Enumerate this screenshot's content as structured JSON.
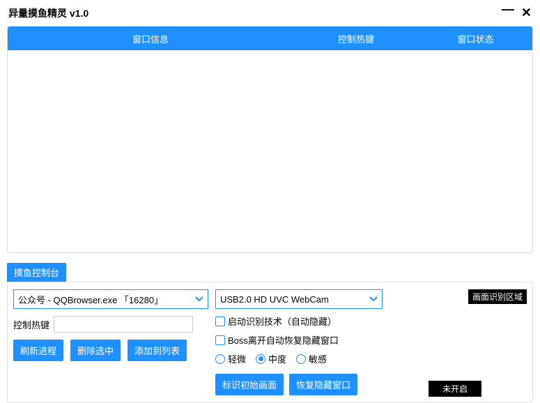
{
  "titlebar": {
    "title": "异量摸鱼精灵 v1.0"
  },
  "headers": {
    "info": "窗口信息",
    "hotkey": "控制热键",
    "status": "窗口状态"
  },
  "section": {
    "title": "摸鱼控制台"
  },
  "left": {
    "process_select": "公众号 - QQBrowser.exe 「16280」",
    "hotkey_label": "控制热键",
    "hotkey_value": "",
    "btn_refresh": "刷新进程",
    "btn_delete": "删除选中",
    "btn_add": "添加到列表"
  },
  "mid": {
    "camera_select": "USB2.0 HD UVC WebCam",
    "chk_enable_detect": "启动识别技术（自动隐藏）",
    "chk_boss_leave": "Boss离开自动恢复隐藏窗口",
    "radio_light": "轻微",
    "radio_medium": "中度",
    "radio_sensitive": "敏感",
    "btn_mark_initial": "标识初始画面",
    "btn_restore_hidden": "恢复隐藏窗口"
  },
  "right": {
    "badge": "画面识别区域",
    "status": "未开启"
  }
}
